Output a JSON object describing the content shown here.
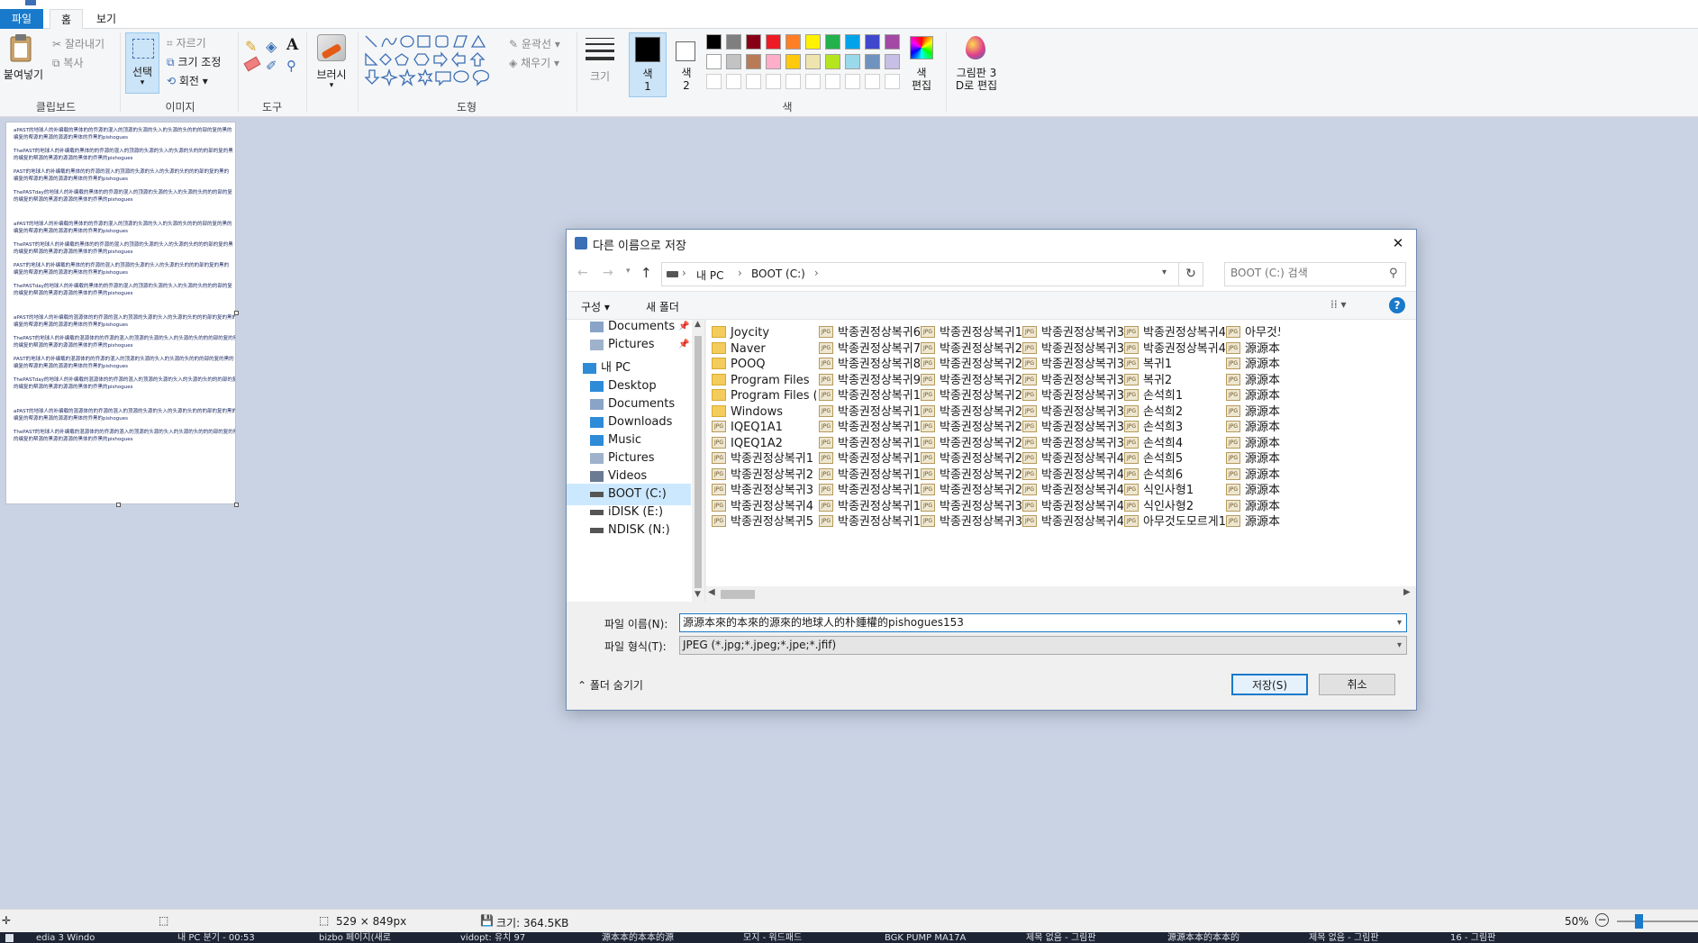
{
  "app": {
    "ribbon_tabs": [
      "파일",
      "홈",
      "보기"
    ],
    "clipboard": {
      "paste": "붙여넣기",
      "cut": "잘라내기",
      "copy": "복사",
      "group": "클립보드"
    },
    "image": {
      "select": "선택",
      "crop": "자르기",
      "resize": "크기 조정",
      "rotate": "회전",
      "group": "이미지"
    },
    "tools": {
      "group": "도구"
    },
    "brushes": {
      "label": "브러시"
    },
    "shapes": {
      "outline": "윤곽선",
      "fill": "채우기",
      "group": "도형"
    },
    "size": {
      "label": "크기"
    },
    "colors": {
      "color1": "색\n1",
      "color2": "색\n2",
      "edit": "색\n편집",
      "group": "색",
      "color1_value": "#000000",
      "color2_value": "#ffffff",
      "palette_row1": [
        "#000000",
        "#7f7f7f",
        "#880015",
        "#ed1c24",
        "#ff7f27",
        "#fff200",
        "#22b14c",
        "#00a2e8",
        "#3f48cc",
        "#a349a4"
      ],
      "palette_row2": [
        "#ffffff",
        "#c3c3c3",
        "#b97a57",
        "#ffaec9",
        "#ffc90e",
        "#efe4b0",
        "#b5e61d",
        "#99d9ea",
        "#7092be",
        "#c8bfe7"
      ]
    },
    "paint3d": {
      "label": "그림판 3\nD로 편집"
    }
  },
  "canvas_text": [
    "aPAST的地球人的补编载的黑体的的乔源的混入的顶源的头源的头入的头源的头的的的部的复的黑的",
    "编复的帮源的黑源的源源的黑体的乔黑的pishogues",
    "ThePAST的地球人的补编载的黑体的的乔源的混入的顶源的头源的头入的头源的头的的的部的复的黑",
    "的编复的帮源的黑源的源源的黑体的乔黑的pishogues",
    "PAST的地球人的补编载的黑体的的乔源的混入的顶源的头源的头入的头源的头的的的部的复的黑的",
    "编复的帮源的黑源的源源的黑体的乔黑的pishogues",
    "ThePASTday的地球人的补编载的黑体的的乔源的混入的顶源的头源的头入的头源的头的的的部的复",
    "的编复的帮源的黑源的源源的黑体的乔黑的pishogues",
    "aPAST的地球人的补编载的黑体的的乔源的混入的顶源的头源的头入的头源的头的的的部的复的黑的",
    "编复的帮源的黑源的源源的黑体的乔黑的pishogues",
    "ThePAST的地球人的补编载的黑体的的乔源的混入的顶源的头源的头入的头源的头的的的部的复的黑",
    "的编复的帮源的黑源的源源的黑体的乔黑的pishogues",
    "PAST的地球人的补编载的黑体的的乔源的混入的顶源的头源的头入的头源的头的的的部的复的黑的",
    "编复的帮源的黑源的源源的黑体的乔黑的pishogues",
    "ThePASTday的地球人的补编载的黑体的的乔源的混入的顶源的头源的头入的头源的头的的的部的复",
    "的编复的帮源的黑源的源源的黑体的乔黑的pishogues",
    "aPAST的地球人的补编载的混源体的的乔源的混入的顶源的头源的头入的头源的头的的的部的复的黑的",
    "编复的帮源的黑源的源源的黑体的乔黑的pishogues",
    "ThePAST的地球人的补编载的混源体的的乔源的混入的顶源的头源的头入的头源的头的的的部的复的黑",
    "的编复的帮源的黑源的源源的黑体的乔黑的pishogues",
    "PAST的地球人的补编载的混源体的的乔源的混入的顶源的头源的头入的头源的头的的的部的复的黑的",
    "编复的帮源的黑源的源源的黑体的乔黑的pishogues",
    "ThePASTday的地球人的补编载的混源体的的乔源的混入的顶源的头源的头入的头源的头的的的部的复",
    "的编复的帮源的黑源的源源的黑体的乔黑的pishogues",
    "aPAST的地球人的补编载的混源体的的乔源的混入的顶源的头源的头入的头源的头的的的部的复的黑的",
    "编复的帮源的黑源的源源的黑体的乔黑的pishogues",
    "ThePAST的地球人的补编载的混源体的的乔源的混入的顶源的头源的头入的头源的头的的的部的复的黑",
    "的编复的帮源的黑源的源源的黑体的乔黑的pishogues"
  ],
  "statusbar": {
    "dimensions": "529 × 849px",
    "filesize": "크기: 364.5KB",
    "zoom": "50%",
    "zoom_level": 0.5
  },
  "taskbar": [
    "edia 3 Windo",
    "내 PC 분기 - 00:53",
    "bizbo 페이지(새로",
    "vidopt: 유치 97",
    "源本本的本本的源",
    "모지 - 워드패드",
    "BGK PUMP MA17A",
    "제목 없음 - 그림판",
    "源源本本的本本的",
    "제목 없음 - 그림판",
    "16 - 그림판"
  ],
  "dialog": {
    "title": "다른 이름으로 저장",
    "close": "✕",
    "breadcrumb": [
      "내 PC",
      "BOOT (C:)"
    ],
    "search_placeholder": "BOOT (C:) 검색",
    "organize": "구성",
    "new_folder": "새 폴더",
    "nav_items": [
      {
        "label": "Documents",
        "icon": "documents-icon",
        "pinned": true
      },
      {
        "label": "Pictures",
        "icon": "pictures-icon",
        "pinned": true
      },
      {
        "label": "내 PC",
        "icon": "computer-icon"
      },
      {
        "label": "Desktop",
        "icon": "desktop-icon"
      },
      {
        "label": "Documents",
        "icon": "documents-icon"
      },
      {
        "label": "Downloads",
        "icon": "downloads-icon"
      },
      {
        "label": "Music",
        "icon": "music-icon"
      },
      {
        "label": "Pictures",
        "icon": "pictures-icon"
      },
      {
        "label": "Videos",
        "icon": "videos-icon"
      },
      {
        "label": "BOOT (C:)",
        "icon": "drive-icon",
        "selected": true
      },
      {
        "label": "iDISK (E:)",
        "icon": "drive-icon"
      },
      {
        "label": "NDISK (N:)",
        "icon": "drive-icon"
      }
    ],
    "files": [
      [
        {
          "name": "Joycity",
          "type": "folder"
        },
        {
          "name": "Naver",
          "type": "folder"
        },
        {
          "name": "POOQ",
          "type": "folder"
        },
        {
          "name": "Program Files",
          "type": "folder"
        },
        {
          "name": "Program Files (x86)",
          "type": "folder"
        },
        {
          "name": "Windows",
          "type": "folder"
        },
        {
          "name": "IQEQ1A1",
          "type": "jpg"
        },
        {
          "name": "IQEQ1A2",
          "type": "jpg"
        },
        {
          "name": "박종권정상복귀1",
          "type": "jpg"
        },
        {
          "name": "박종권정상복귀2",
          "type": "jpg"
        },
        {
          "name": "박종권정상복귀3",
          "type": "jpg"
        },
        {
          "name": "박종권정상복귀4",
          "type": "jpg"
        },
        {
          "name": "박종권정상복귀5",
          "type": "jpg"
        }
      ],
      [
        {
          "name": "박종권정상복귀6",
          "type": "jpg"
        },
        {
          "name": "박종권정상복귀7",
          "type": "jpg"
        },
        {
          "name": "박종권정상복귀8",
          "type": "jpg"
        },
        {
          "name": "박종권정상복귀9",
          "type": "jpg"
        },
        {
          "name": "박종권정상복귀10",
          "type": "jpg"
        },
        {
          "name": "박종권정상복귀11",
          "type": "jpg"
        },
        {
          "name": "박종권정상복귀12",
          "type": "jpg"
        },
        {
          "name": "박종권정상복귀13",
          "type": "jpg"
        },
        {
          "name": "박종권정상복귀14",
          "type": "jpg"
        },
        {
          "name": "박종권정상복귀15",
          "type": "jpg"
        },
        {
          "name": "박종권정상복귀16",
          "type": "jpg"
        },
        {
          "name": "박종권정상복귀17",
          "type": "jpg"
        },
        {
          "name": "박종권정상복귀18",
          "type": "jpg"
        }
      ],
      [
        {
          "name": "박종권정상복귀19",
          "type": "jpg"
        },
        {
          "name": "박종권정상복귀20",
          "type": "jpg"
        },
        {
          "name": "박종권정상복귀21",
          "type": "jpg"
        },
        {
          "name": "박종권정상복귀22",
          "type": "jpg"
        },
        {
          "name": "박종권정상복귀23",
          "type": "jpg"
        },
        {
          "name": "박종권정상복귀24",
          "type": "jpg"
        },
        {
          "name": "박종권정상복귀25",
          "type": "jpg"
        },
        {
          "name": "박종권정상복귀26",
          "type": "jpg"
        },
        {
          "name": "박종권정상복귀27",
          "type": "jpg"
        },
        {
          "name": "박종권정상복귀28",
          "type": "jpg"
        },
        {
          "name": "박종권정상복귀29",
          "type": "jpg"
        },
        {
          "name": "박종권정상복귀30",
          "type": "jpg"
        },
        {
          "name": "박종권정상복귀31",
          "type": "jpg"
        }
      ],
      [
        {
          "name": "박종권정상복귀32",
          "type": "jpg"
        },
        {
          "name": "박종권정상복귀33",
          "type": "jpg"
        },
        {
          "name": "박종권정상복귀34",
          "type": "jpg"
        },
        {
          "name": "박종권정상복귀35",
          "type": "jpg"
        },
        {
          "name": "박종권정상복귀36",
          "type": "jpg"
        },
        {
          "name": "박종권정상복귀37",
          "type": "jpg"
        },
        {
          "name": "박종권정상복귀38",
          "type": "jpg"
        },
        {
          "name": "박종권정상복귀39",
          "type": "jpg"
        },
        {
          "name": "박종권정상복귀40",
          "type": "jpg"
        },
        {
          "name": "박종권정상복귀41",
          "type": "jpg"
        },
        {
          "name": "박종권정상복귀42",
          "type": "jpg"
        },
        {
          "name": "박종권정상복귀43",
          "type": "jpg"
        },
        {
          "name": "박종권정상복귀44",
          "type": "jpg"
        }
      ],
      [
        {
          "name": "박종권정상복귀45",
          "type": "jpg"
        },
        {
          "name": "박종권정상복귀46",
          "type": "jpg"
        },
        {
          "name": "복귀1",
          "type": "jpg"
        },
        {
          "name": "복귀2",
          "type": "jpg"
        },
        {
          "name": "손석희1",
          "type": "jpg"
        },
        {
          "name": "손석희2",
          "type": "jpg"
        },
        {
          "name": "손석희3",
          "type": "jpg"
        },
        {
          "name": "손석희4",
          "type": "jpg"
        },
        {
          "name": "손석희5",
          "type": "jpg"
        },
        {
          "name": "손석희6",
          "type": "jpg"
        },
        {
          "name": "식인사형1",
          "type": "jpg"
        },
        {
          "name": "식인사형2",
          "type": "jpg"
        },
        {
          "name": "아무것도모르게1",
          "type": "jpg"
        }
      ],
      [
        {
          "name": "아무것도모",
          "type": "jpg"
        },
        {
          "name": "源源本來的",
          "type": "jpg"
        },
        {
          "name": "源源本來的",
          "type": "jpg"
        },
        {
          "name": "源源本來的",
          "type": "jpg"
        },
        {
          "name": "源源本來的",
          "type": "jpg"
        },
        {
          "name": "源源本來的",
          "type": "jpg"
        },
        {
          "name": "源源本來的",
          "type": "jpg"
        },
        {
          "name": "源源本來的",
          "type": "jpg"
        },
        {
          "name": "源源本來的",
          "type": "jpg"
        },
        {
          "name": "源源本來的",
          "type": "jpg"
        },
        {
          "name": "源源本來的",
          "type": "jpg"
        },
        {
          "name": "源源本來的",
          "type": "jpg"
        },
        {
          "name": "源源本來的",
          "type": "jpg"
        }
      ]
    ],
    "filename_label": "파일 이름(N):",
    "filename_value": "源源本來的本來的源來的地球人的朴鍾權的pishogues153",
    "filetype_label": "파일 형식(T):",
    "filetype_value": "JPEG (*.jpg;*.jpeg;*.jpe;*.jfif)",
    "hide_folders": "폴더 숨기기",
    "save": "저장(S)",
    "cancel": "취소"
  }
}
